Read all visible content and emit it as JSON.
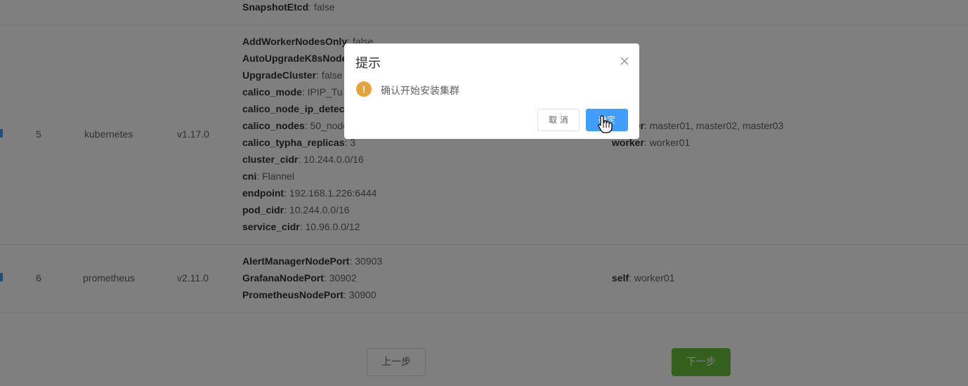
{
  "table": {
    "row_top_partial": {
      "params": [
        {
          "key": "SnapshotEtcd",
          "value": ": false"
        }
      ]
    },
    "row_kubernetes": {
      "index": "5",
      "name": "kubernetes",
      "version": "v1.17.0",
      "params": [
        {
          "key": "AddWorkerNodesOnly",
          "value": ": false"
        },
        {
          "key": "AutoUpgradeK8sNodes",
          "value": ""
        },
        {
          "key": "UpgradeCluster",
          "value": ": false"
        },
        {
          "key": "calico_mode",
          "value": ": IPIP_Tu"
        },
        {
          "key": "calico_node_ip_detec",
          "value": ""
        },
        {
          "key": "calico_nodes",
          "value": ": 50_node"
        },
        {
          "key": "calico_typha_replicas",
          "value": ": 3"
        },
        {
          "key": "cluster_cidr",
          "value": ": 10.244.0.0/16"
        },
        {
          "key": "cni",
          "value": ": Flannel"
        },
        {
          "key": "endpoint",
          "value": ": 192.168.1.226:6444"
        },
        {
          "key": "pod_cidr",
          "value": ": 10.244.0.0/16"
        },
        {
          "key": "service_cidr",
          "value": ": 10.96.0.0/12"
        }
      ],
      "nodes": [
        {
          "key": "master",
          "value": ": master01, master02, master03"
        },
        {
          "key": "worker",
          "value": ": worker01"
        }
      ]
    },
    "row_prometheus": {
      "index": "6",
      "name": "prometheus",
      "version": "v2.11.0",
      "params": [
        {
          "key": "AlertManagerNodePort",
          "value": ": 30903"
        },
        {
          "key": "GrafanaNodePort",
          "value": ": 30902"
        },
        {
          "key": "PrometheusNodePort",
          "value": ": 30900"
        }
      ],
      "nodes": [
        {
          "key": "self",
          "value": ": worker01"
        }
      ]
    }
  },
  "footer": {
    "prev_label": "上一步",
    "next_label": "下一步"
  },
  "dialog": {
    "title": "提示",
    "message": "确认开始安装集群",
    "warning_glyph": "!",
    "cancel_label": "取 消",
    "confirm_label": "确定"
  },
  "colors": {
    "primary": "#409eff",
    "success": "#67c23a",
    "warning": "#e6a23c",
    "mask": "rgba(0,0,0,0.5)"
  },
  "icons": [
    "close-icon",
    "warning-icon",
    "hand-pointer-icon"
  ]
}
